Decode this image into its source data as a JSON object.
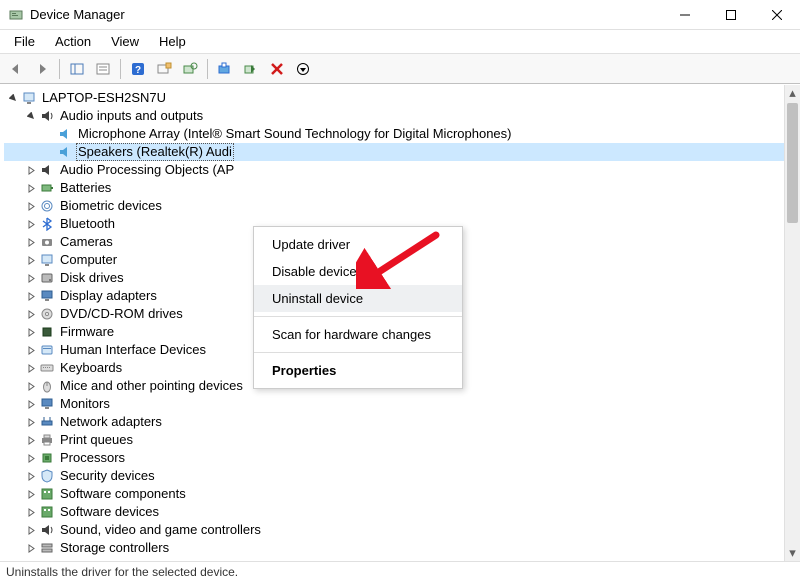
{
  "titlebar": {
    "title": "Device Manager"
  },
  "menubar": {
    "items": [
      {
        "label": "File"
      },
      {
        "label": "Action"
      },
      {
        "label": "View"
      },
      {
        "label": "Help"
      }
    ]
  },
  "tree": {
    "root": {
      "label": "LAPTOP-ESH2SN7U",
      "expanded": true
    },
    "audio": {
      "label": "Audio inputs and outputs",
      "expanded": true,
      "children": [
        {
          "label": "Microphone Array (Intel® Smart Sound Technology for Digital Microphones)"
        },
        {
          "label": "Speakers (Realtek(R) Audi",
          "selected": true
        }
      ]
    },
    "categories": [
      {
        "label": "Audio Processing Objects (AP",
        "icon": "audio"
      },
      {
        "label": "Batteries",
        "icon": "battery"
      },
      {
        "label": "Biometric devices",
        "icon": "fingerprint"
      },
      {
        "label": "Bluetooth",
        "icon": "bluetooth"
      },
      {
        "label": "Cameras",
        "icon": "camera"
      },
      {
        "label": "Computer",
        "icon": "computer"
      },
      {
        "label": "Disk drives",
        "icon": "disk"
      },
      {
        "label": "Display adapters",
        "icon": "display"
      },
      {
        "label": "DVD/CD-ROM drives",
        "icon": "disc"
      },
      {
        "label": "Firmware",
        "icon": "firmware"
      },
      {
        "label": "Human Interface Devices",
        "icon": "hid"
      },
      {
        "label": "Keyboards",
        "icon": "keyboard"
      },
      {
        "label": "Mice and other pointing devices",
        "icon": "mouse"
      },
      {
        "label": "Monitors",
        "icon": "monitor"
      },
      {
        "label": "Network adapters",
        "icon": "network"
      },
      {
        "label": "Print queues",
        "icon": "printer"
      },
      {
        "label": "Processors",
        "icon": "cpu"
      },
      {
        "label": "Security devices",
        "icon": "security"
      },
      {
        "label": "Software components",
        "icon": "sw"
      },
      {
        "label": "Software devices",
        "icon": "sw"
      },
      {
        "label": "Sound, video and game controllers",
        "icon": "sound"
      },
      {
        "label": "Storage controllers",
        "icon": "storage"
      }
    ]
  },
  "context_menu": {
    "items": [
      {
        "label": "Update driver"
      },
      {
        "label": "Disable device"
      },
      {
        "label": "Uninstall device",
        "highlight": true
      },
      {
        "sep": true
      },
      {
        "label": "Scan for hardware changes"
      },
      {
        "sep": true
      },
      {
        "label": "Properties",
        "bold": true
      }
    ]
  },
  "statusbar": {
    "text": "Uninstalls the driver for the selected device."
  }
}
